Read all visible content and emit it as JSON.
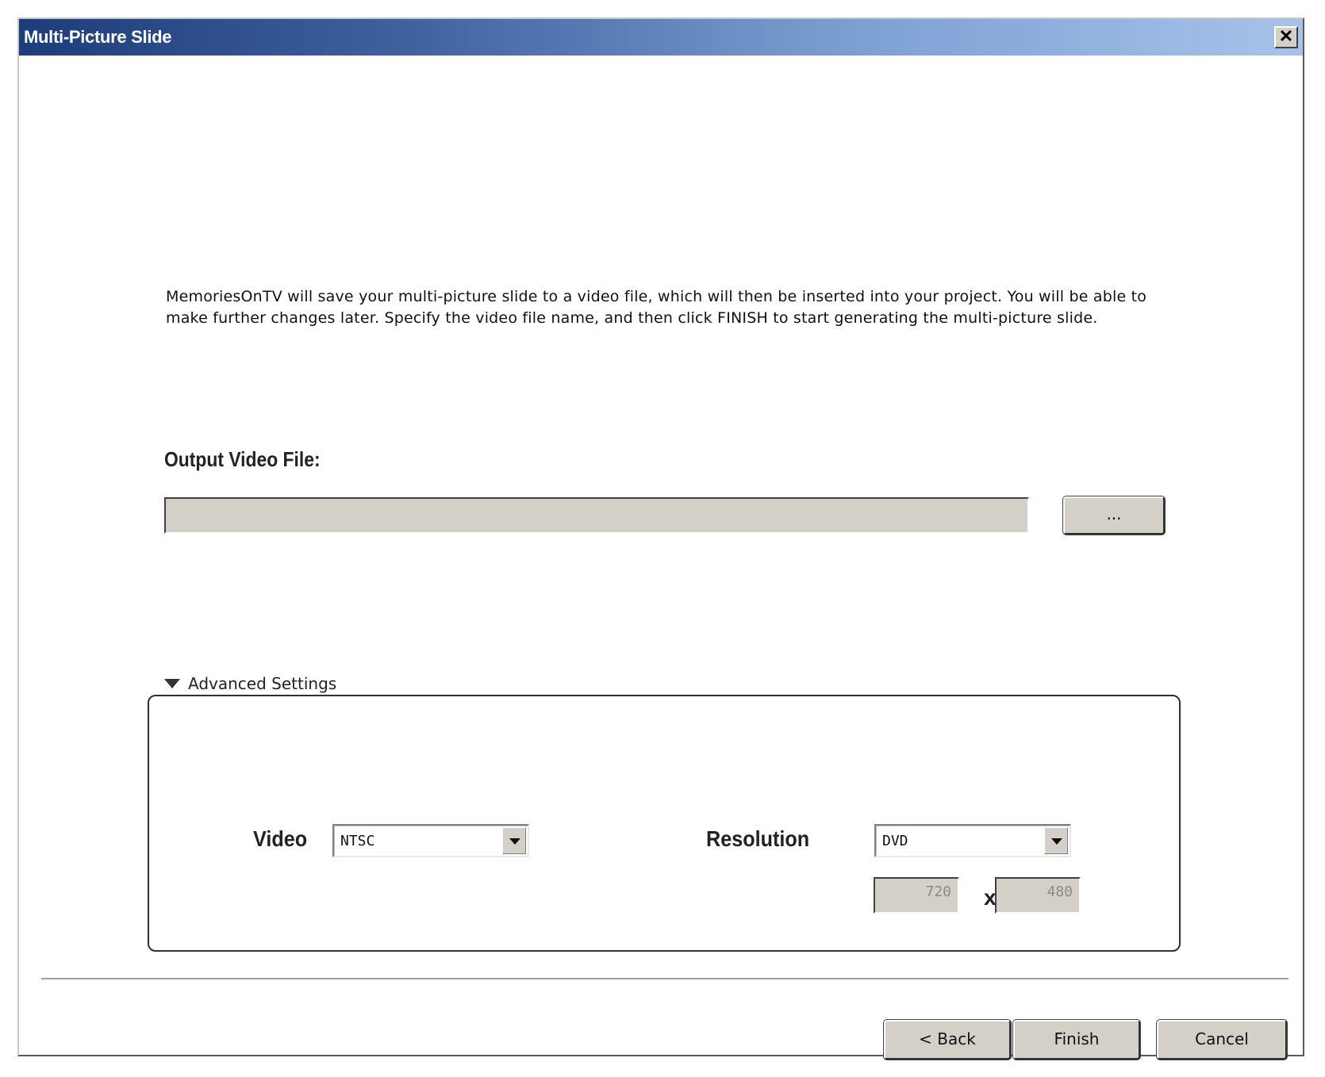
{
  "window": {
    "title": "Multi-Picture Slide",
    "close_glyph": "✕"
  },
  "description": "MemoriesOnTV will save your multi-picture slide to a video file, which will then be inserted into your project. You will be able to make further changes later. Specify the video file name, and then click FINISH to start generating the multi-picture slide.",
  "output": {
    "label": "Output Video File:",
    "value": "",
    "browse_label": "..."
  },
  "advanced": {
    "toggle_label": "Advanced Settings",
    "video_label": "Video",
    "video_value": "NTSC",
    "resolution_label": "Resolution",
    "resolution_value": "DVD",
    "width": "720",
    "times": "x",
    "height": "480"
  },
  "footer": {
    "back_label": "< Back",
    "finish_label": "Finish",
    "cancel_label": "Cancel"
  }
}
